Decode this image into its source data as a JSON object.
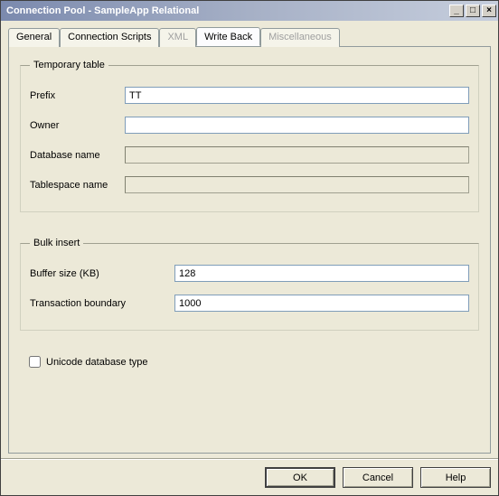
{
  "window": {
    "title": "Connection Pool - SampleApp Relational"
  },
  "tabs": {
    "general": "General",
    "connectionScripts": "Connection Scripts",
    "xml": "XML",
    "writeBack": "Write Back",
    "misc": "Miscellaneous"
  },
  "groups": {
    "tempTable": {
      "legend": "Temporary table",
      "prefixLabel": "Prefix",
      "prefixValue": "TT",
      "ownerLabel": "Owner",
      "ownerValue": "",
      "dbNameLabel": "Database name",
      "dbNameValue": "",
      "tsNameLabel": "Tablespace name",
      "tsNameValue": ""
    },
    "bulk": {
      "legend": "Bulk insert",
      "bufferLabel": "Buffer size (KB)",
      "bufferValue": "128",
      "txnLabel": "Transaction boundary",
      "txnValue": "1000"
    }
  },
  "unicodeLabel": "Unicode database type",
  "buttons": {
    "ok": "OK",
    "cancel": "Cancel",
    "help": "Help"
  }
}
